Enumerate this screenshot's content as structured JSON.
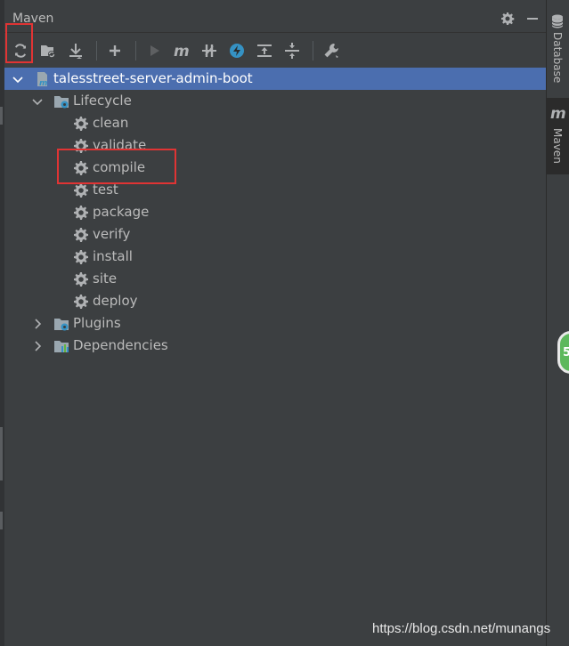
{
  "panel": {
    "title": "Maven"
  },
  "toolbar": {
    "items": [
      {
        "name": "reload-all-projects",
        "icon": "reload-icon"
      },
      {
        "name": "generate-sources",
        "icon": "folder-refresh-icon"
      },
      {
        "name": "download-sources",
        "icon": "download-icon"
      },
      {
        "name": "add-maven-project",
        "icon": "plus-icon"
      },
      {
        "name": "run-maven-build",
        "icon": "play-icon"
      },
      {
        "name": "execute-maven-goal",
        "icon": "maven-m-icon"
      },
      {
        "name": "toggle-offline-mode",
        "icon": "offline-icon"
      },
      {
        "name": "toggle-skip-tests",
        "icon": "lightning-icon"
      },
      {
        "name": "show-dependencies",
        "icon": "expand-all-icon"
      },
      {
        "name": "collapse-all",
        "icon": "collapse-all-icon"
      },
      {
        "name": "maven-settings",
        "icon": "wrench-icon"
      }
    ]
  },
  "tree": {
    "project": "talesstreet-server-admin-boot",
    "lifecycle_label": "Lifecycle",
    "phases": [
      "clean",
      "validate",
      "compile",
      "test",
      "package",
      "verify",
      "install",
      "site",
      "deploy"
    ],
    "plugins_label": "Plugins",
    "dependencies_label": "Dependencies"
  },
  "right_stripe": {
    "database_label": "Database",
    "maven_label": "Maven",
    "maven_glyph": "m"
  },
  "float_badge": "5",
  "watermark": "https://blog.csdn.net/munangs",
  "colors": {
    "background": "#3c3f41",
    "selection": "#4b6eaf",
    "text": "#bbbbbb",
    "icon": "#afb1b3",
    "annotation": "#e03434",
    "maven_blue": "#3592c4"
  }
}
